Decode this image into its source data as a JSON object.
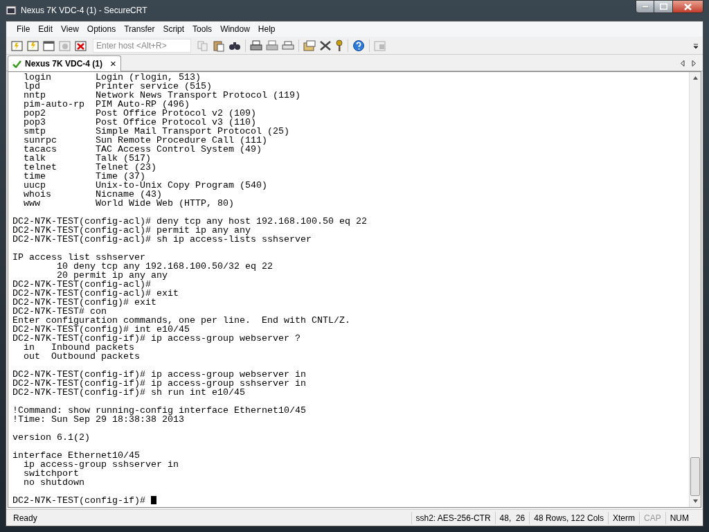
{
  "window": {
    "title": "Nexus 7K VDC-4 (1) - SecureCRT"
  },
  "menu": [
    "File",
    "Edit",
    "View",
    "Options",
    "Transfer",
    "Script",
    "Tools",
    "Window",
    "Help"
  ],
  "toolbar": {
    "host_field": {
      "placeholder": "Enter host <Alt+R>"
    }
  },
  "tabs": [
    {
      "label": "Nexus 7K VDC-4 (1)",
      "selected": true,
      "close": "×"
    }
  ],
  "terminal": {
    "blocks": [
      [
        "  login        Login (rlogin, 513)",
        "  lpd          Printer service (515)",
        "  nntp         Network News Transport Protocol (119)",
        "  pim-auto-rp  PIM Auto-RP (496)",
        "  pop2         Post Office Protocol v2 (109)",
        "  pop3         Post Office Protocol v3 (110)",
        "  smtp         Simple Mail Transport Protocol (25)",
        "  sunrpc       Sun Remote Procedure Call (111)",
        "  tacacs       TAC Access Control System (49)",
        "  talk         Talk (517)",
        "  telnet       Telnet (23)",
        "  time         Time (37)",
        "  uucp         Unix-to-Unix Copy Program (540)",
        "  whois        Nicname (43)",
        "  www          World Wide Web (HTTP, 80)"
      ],
      [
        "DC2-N7K-TEST(config-acl)# deny tcp any host 192.168.100.50 eq 22",
        "DC2-N7K-TEST(config-acl)# permit ip any any",
        "DC2-N7K-TEST(config-acl)# sh ip access-lists sshserver"
      ],
      [
        "IP access list sshserver",
        "        10 deny tcp any 192.168.100.50/32 eq 22",
        "        20 permit ip any any",
        "DC2-N7K-TEST(config-acl)#",
        "DC2-N7K-TEST(config-acl)# exit",
        "DC2-N7K-TEST(config)# exit",
        "DC2-N7K-TEST# con",
        "Enter configuration commands, one per line.  End with CNTL/Z.",
        "DC2-N7K-TEST(config)# int e10/45",
        "DC2-N7K-TEST(config-if)# ip access-group webserver ?",
        "  in   Inbound packets",
        "  out  Outbound packets"
      ],
      [
        "DC2-N7K-TEST(config-if)# ip access-group webserver in",
        "DC2-N7K-TEST(config-if)# ip access-group sshserver in",
        "DC2-N7K-TEST(config-if)# sh run int e10/45"
      ],
      [
        "!Command: show running-config interface Ethernet10/45",
        "!Time: Sun Sep 29 18:38:38 2013"
      ],
      [
        "version 6.1(2)"
      ],
      [
        "interface Ethernet10/45",
        "  ip access-group sshserver in",
        "  switchport",
        "  no shutdown"
      ]
    ],
    "prompt": "DC2-N7K-TEST(config-if)#"
  },
  "status_bar": [
    {
      "text": "Ready",
      "kind": "message",
      "active": true
    },
    {
      "text": "ssh2: AES-256-CTR",
      "kind": "field",
      "active": true
    },
    {
      "text": "48,  26",
      "kind": "field",
      "active": true
    },
    {
      "text": "48 Rows, 122 Cols",
      "kind": "field",
      "active": true
    },
    {
      "text": "Xterm",
      "kind": "field",
      "active": true
    },
    {
      "text": "CAP",
      "kind": "field",
      "active": false
    },
    {
      "text": "NUM",
      "kind": "field",
      "active": true
    }
  ]
}
